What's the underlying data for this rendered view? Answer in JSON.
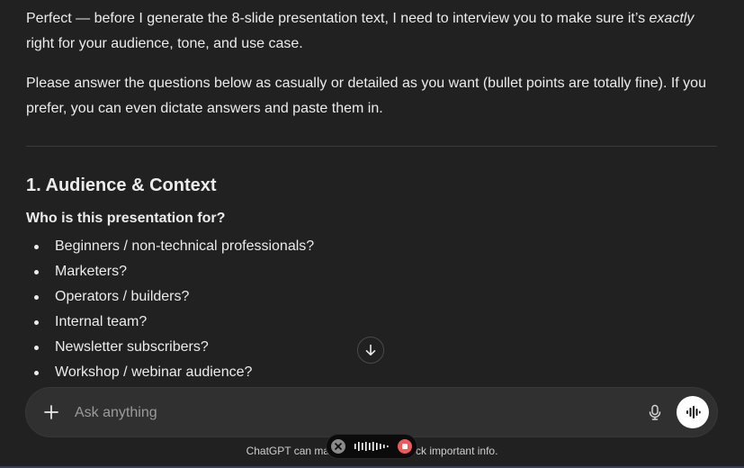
{
  "message": {
    "intro_parts": [
      "Perfect — before I generate the 8-slide presentation text, I need to interview you to make sure it’s ",
      "exactly",
      " right for your audience, tone, and use case."
    ],
    "instructions": "Please answer the questions below as casually or detailed as you want (bullet points are totally fine). If you prefer, you can even dictate answers and paste them in.",
    "section_heading": "1. Audience & Context",
    "question": "Who is this presentation for?",
    "options": [
      "Beginners / non-technical professionals?",
      "Marketers?",
      "Operators / builders?",
      "Internal team?",
      "Newsletter subscribers?",
      "Workshop / webinar audience?"
    ]
  },
  "composer": {
    "placeholder": "Ask anything",
    "plus_icon": "plus-icon",
    "mic_icon": "microphone-icon",
    "voice_icon": "voice-mode-icon"
  },
  "footer": {
    "text_left": "ChatGPT can ma",
    "text_right": "ck important info."
  },
  "recording": {
    "close_icon": "close-icon",
    "wave_icon": "waveform-icon",
    "stop_icon": "stop-icon",
    "stop_color": "#ee5a5a"
  },
  "colors": {
    "background": "#212121",
    "text": "#ececec",
    "composer": "#303030"
  }
}
